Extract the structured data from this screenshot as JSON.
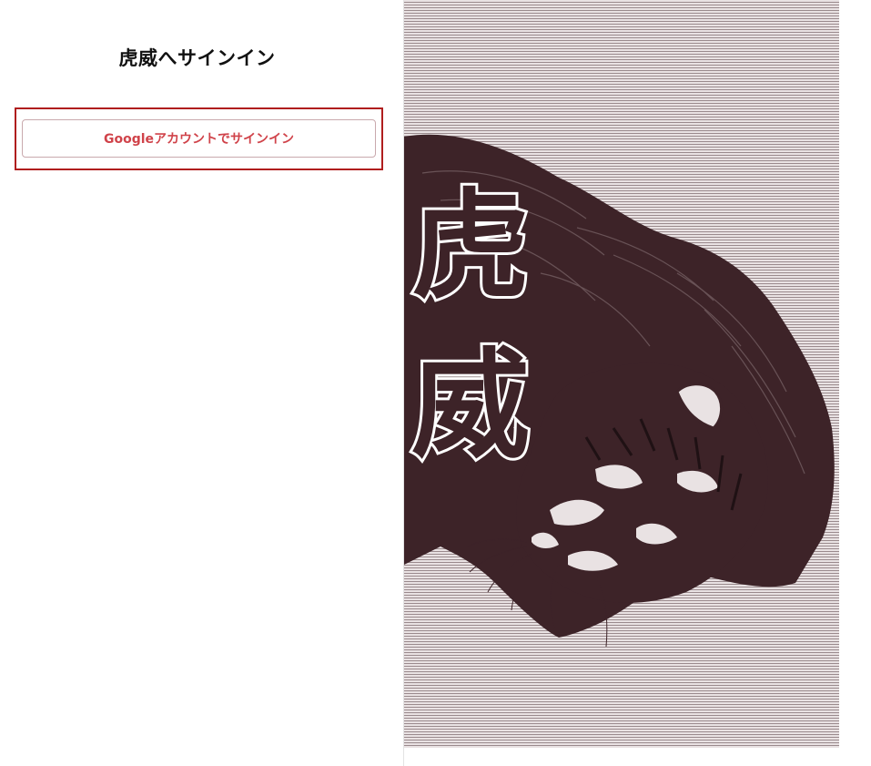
{
  "signin": {
    "title": "虎威へサインイン",
    "google_button_label": "Googleアカウントでサインイン"
  },
  "hero": {
    "calligraphy": "虎威",
    "image": "tiger-illustration",
    "colors": {
      "ink": "#3d2328",
      "background": "#e9e2e3",
      "accent": "#d0434a",
      "highlight_border": "#b01e1e"
    }
  }
}
